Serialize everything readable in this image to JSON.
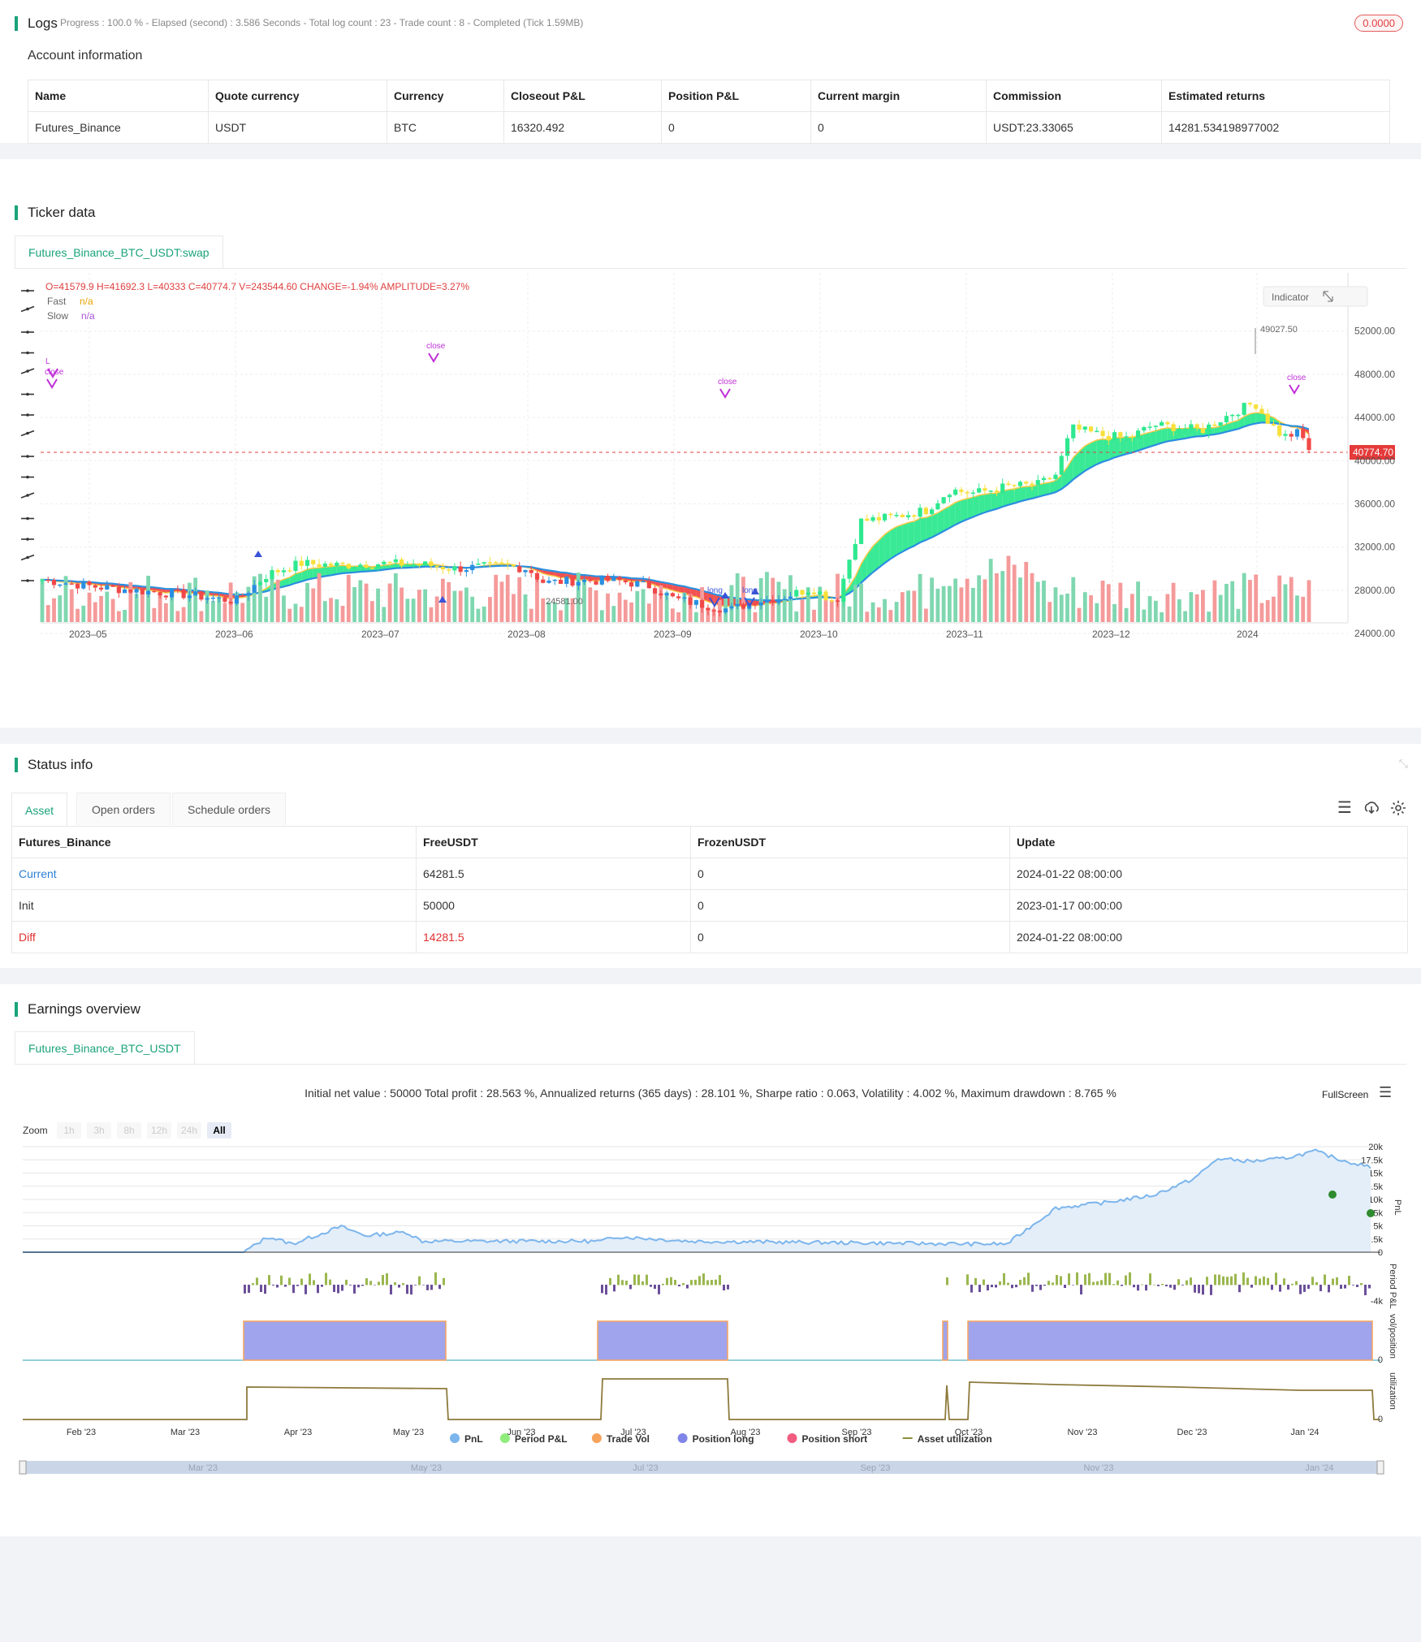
{
  "logs": {
    "title": "Logs",
    "progress": "Progress : 100.0 % - Elapsed (second) : 3.586  Seconds - Total log count : 23 - Trade count : 8 - Completed (Tick 1.59MB)",
    "badge": "0.0000",
    "account_title": "Account information",
    "columns": [
      "Name",
      "Quote currency",
      "Currency",
      "Closeout P&L",
      "Position P&L",
      "Current margin",
      "Commission",
      "Estimated returns"
    ],
    "row": [
      "Futures_Binance",
      "USDT",
      "BTC",
      "16320.492",
      "0",
      "0",
      "USDT:23.33065",
      "14281.534198977002"
    ]
  },
  "ticker": {
    "title": "Ticker data",
    "tab": "Futures_Binance_BTC_USDT:swap",
    "ohlc": "O=41579.9 H=41692.3 L=40333 C=40774.7 V=243544.60 CHANGE=-1.94% AMPLITUDE=3.27%",
    "fast_label": "Fast",
    "fast_val": "n/a",
    "slow_label": "Slow",
    "slow_val": "n/a",
    "indicator_btn": "Indicator",
    "price_ticks": [
      "52000.00",
      "48000.00",
      "44000.00",
      "40000.00",
      "36000.00",
      "32000.00",
      "28000.00",
      "24000.00"
    ],
    "date_ticks": [
      "2023–05",
      "2023–06",
      "2023–07",
      "2023–08",
      "2023–09",
      "2023–10",
      "2023–11",
      "2023–12",
      "2024"
    ],
    "last_price": "40774.70",
    "high_label": "49027.50",
    "low_label": "24581.00",
    "marks": [
      "close",
      "close",
      "close",
      "close",
      "long",
      "long",
      "L"
    ],
    "colors": {
      "up": "#2ee88f",
      "down": "#f04848",
      "fast": "#f7c948",
      "slow": "#2a8fe0",
      "band_up": "#2ee88f",
      "band_down": "#f04848"
    }
  },
  "status": {
    "title": "Status info",
    "tabs": [
      "Asset",
      "Open orders",
      "Schedule orders"
    ],
    "columns": [
      "Futures_Binance",
      "FreeUSDT",
      "FrozenUSDT",
      "Update"
    ],
    "rows": [
      [
        "Current",
        "64281.5",
        "0",
        "2024-01-22 08:00:00"
      ],
      [
        "Init",
        "50000",
        "0",
        "2023-01-17 00:00:00"
      ],
      [
        "Diff",
        "14281.5",
        "0",
        "2024-01-22 08:00:00"
      ]
    ]
  },
  "earnings": {
    "title": "Earnings overview",
    "tab": "Futures_Binance_BTC_USDT",
    "summary": "Initial net value : 50000 Total profit : 28.563 %, Annualized returns (365 days) : 28.101 %, Sharpe ratio : 0.063, Volatility : 4.002 %, Maximum drawdown : 8.765 %",
    "fullscreen": "FullScreen",
    "zoom_label": "Zoom",
    "zoom_options": [
      "1h",
      "3h",
      "8h",
      "12h",
      "24h",
      "All"
    ],
    "pnl_ticks": [
      "20k",
      "17.5k",
      "15k",
      "12.5k",
      "10k",
      "7.5k",
      "5k",
      "2.5k",
      "0"
    ],
    "period_ticks": [
      "-4k"
    ],
    "axis_titles": [
      "PnL",
      "Period P&L",
      "vol/position",
      "utilization"
    ],
    "zero_labels": [
      "0",
      "0"
    ],
    "date_ticks": [
      "Feb '23",
      "Mar '23",
      "Apr '23",
      "May '23",
      "Jun '23",
      "Jul '23",
      "Aug '23",
      "Sep '23",
      "Oct '23",
      "Nov '23",
      "Dec '23",
      "Jan '24"
    ],
    "nav_ticks": [
      "Mar '23",
      "May '23",
      "Jul '23",
      "Sep '23",
      "Nov '23",
      "Jan '24"
    ],
    "legend": [
      {
        "name": "PnL",
        "color": "#7cb5ec"
      },
      {
        "name": "Period P&L",
        "color": "#90ed7d"
      },
      {
        "name": "Trade Vol",
        "color": "#f7a35c"
      },
      {
        "name": "Position long",
        "color": "#8085e9"
      },
      {
        "name": "Position short",
        "color": "#f15c80"
      },
      {
        "name": "Asset utilization",
        "color": "#8d8d3c"
      }
    ]
  }
}
